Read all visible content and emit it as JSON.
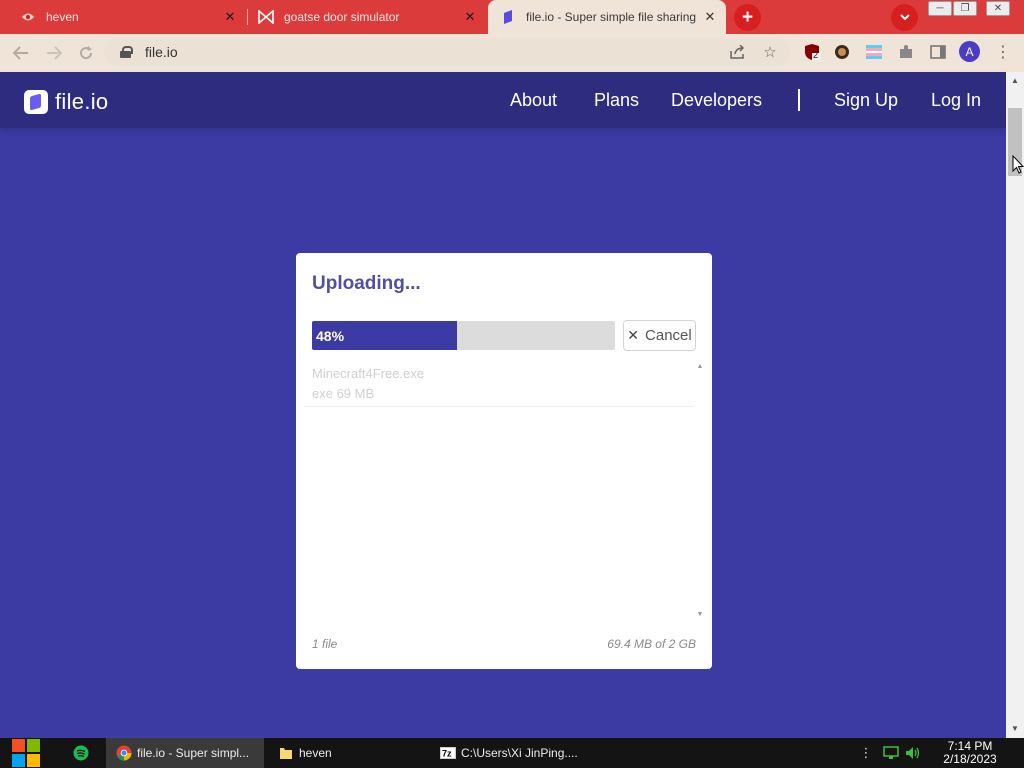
{
  "browser": {
    "tabs": [
      {
        "title": "heven",
        "favicon": "heven-favicon",
        "active": false
      },
      {
        "title": "goatse door simulator",
        "favicon": "bow-favicon",
        "active": false
      },
      {
        "title": "file.io - Super simple file sharing",
        "favicon": "fileio-favicon",
        "active": true
      }
    ],
    "new_tab_symbol": "+",
    "tab_search_symbol": "⌄",
    "url": "file.io",
    "extensions": [
      "ublock-icon",
      "profile-photo-icon",
      "pride-icon",
      "puzzle-icon",
      "sidebar-icon"
    ],
    "ublock_badge": "2",
    "profile_initial": "A"
  },
  "site": {
    "logo_text": "file.io",
    "nav": [
      {
        "label": "About"
      },
      {
        "label": "Plans"
      },
      {
        "label": "Developers"
      },
      {
        "label": "Sign Up"
      },
      {
        "label": "Log In"
      }
    ]
  },
  "upload": {
    "title": "Uploading...",
    "progress_percent": 48,
    "progress_label": "48%",
    "cancel_symbol": "✕",
    "cancel_label": "Cancel",
    "files": [
      {
        "name": "Minecraft4Free.exe",
        "meta": "exe 69 MB"
      }
    ],
    "file_count": "1 file",
    "usage": "69.4 MB of 2 GB"
  },
  "taskbar": {
    "apps": [
      {
        "label": "file.io - Super simpl...",
        "icon": "chrome-icon",
        "active": true
      },
      {
        "label": "heven",
        "icon": "file-explorer-icon",
        "active": false
      },
      {
        "label": "C:\\Users\\Xi JinPing....",
        "icon": "7zip-icon",
        "active": false
      }
    ],
    "time": "7:14 PM",
    "date": "2/18/2023"
  },
  "colors": {
    "tab_strip": "#dc3b3b",
    "page_background": "#3c3aa3",
    "site_header": "#2e2c7e",
    "progress_fill": "#3c3aa3"
  }
}
